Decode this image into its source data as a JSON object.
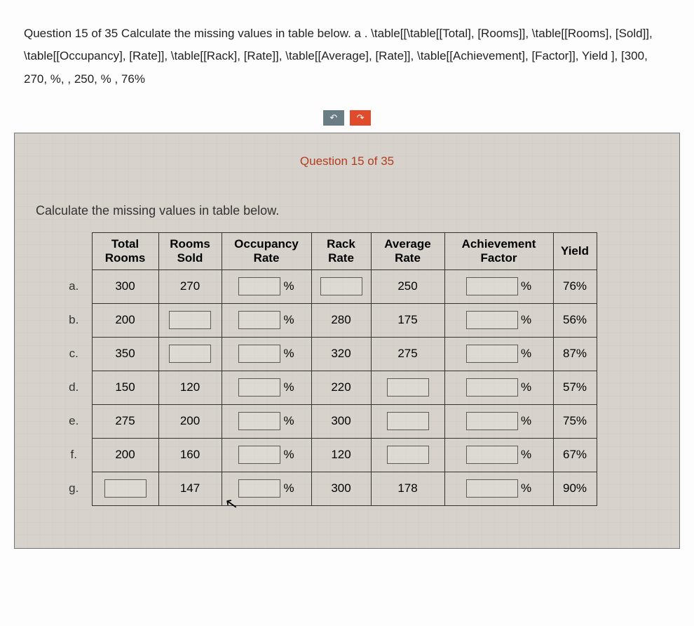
{
  "header": {
    "text": "Question 15 of 35 Calculate the missing values in table below. a .  \\table[[\\table[[Total], [Rooms]], \\table[[Rooms], [Sold]], \\table[[Occupancy], [Rate]], \\table[[Rack], [Rate]], \\table[[Average], [Rate]], \\table[[Achievement], [Factor]], Yield ], [300, 270,  %, , 250,  % , 76%"
  },
  "controls": {
    "undo_icon": "↶",
    "redo_icon": "↷"
  },
  "card": {
    "question_label": "Question 15 of 35",
    "prompt": "Calculate the missing values in table below."
  },
  "columns": {
    "total": "Total Rooms",
    "sold": "Rooms Sold",
    "occ": "Occupancy Rate",
    "rack": "Rack Rate",
    "avg": "Average Rate",
    "ach": "Achievement Factor",
    "yield": "Yield"
  },
  "pct": "%",
  "rows": [
    {
      "label": "a.",
      "total": "300",
      "sold": "270",
      "occ": null,
      "rack": null,
      "avg": "250",
      "ach": null,
      "yield": "76%"
    },
    {
      "label": "b.",
      "total": "200",
      "sold": null,
      "occ": null,
      "rack": "280",
      "avg": "175",
      "ach": null,
      "yield": "56%"
    },
    {
      "label": "c.",
      "total": "350",
      "sold": null,
      "occ": null,
      "rack": "320",
      "avg": "275",
      "ach": null,
      "yield": "87%"
    },
    {
      "label": "d.",
      "total": "150",
      "sold": "120",
      "occ": null,
      "rack": "220",
      "avg": null,
      "ach": null,
      "yield": "57%"
    },
    {
      "label": "e.",
      "total": "275",
      "sold": "200",
      "occ": null,
      "rack": "300",
      "avg": null,
      "ach": null,
      "yield": "75%"
    },
    {
      "label": "f.",
      "total": "200",
      "sold": "160",
      "occ": null,
      "rack": "120",
      "avg": null,
      "ach": null,
      "yield": "67%"
    },
    {
      "label": "g.",
      "total": null,
      "sold": "147",
      "occ": null,
      "rack": "300",
      "avg": "178",
      "ach": null,
      "yield": "90%"
    }
  ]
}
